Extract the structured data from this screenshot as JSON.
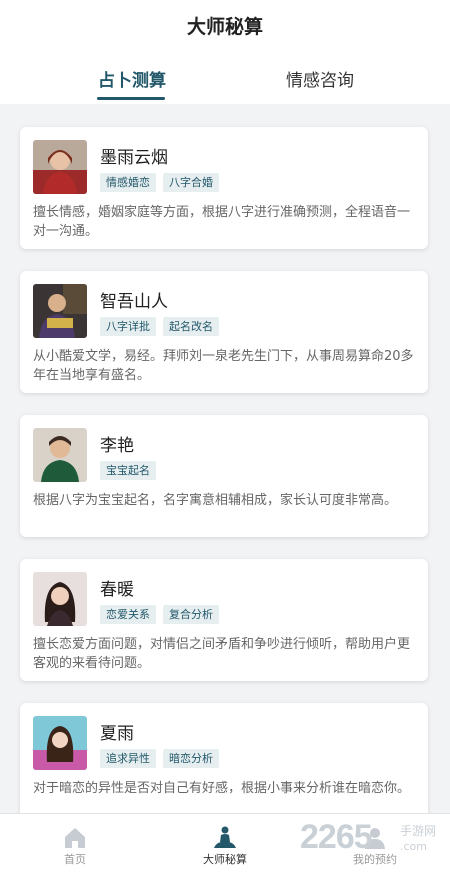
{
  "header": {
    "title": "大师秘算"
  },
  "tabs": [
    {
      "label": "占卜测算",
      "active": true
    },
    {
      "label": "情感咨询",
      "active": false
    }
  ],
  "masters": [
    {
      "name": "墨雨云烟",
      "tags": [
        "情感婚恋",
        "八字合婚"
      ],
      "desc": "擅长情感，婚姻家庭等方面，根据八字进行准确预测，全程语音一对一沟通。"
    },
    {
      "name": "智吾山人",
      "tags": [
        "八字详批",
        "起名改名"
      ],
      "desc": "从小酷爱文学，易经。拜师刘一泉老先生门下，从事周易算命20多年在当地享有盛名。"
    },
    {
      "name": "李艳",
      "tags": [
        "宝宝起名"
      ],
      "desc": "根据八字为宝宝起名，名字寓意相辅相成，家长认可度非常高。"
    },
    {
      "name": "春暖",
      "tags": [
        "恋爱关系",
        "复合分析"
      ],
      "desc": "擅长恋爱方面问题，对情侣之间矛盾和争吵进行倾听，帮助用户更客观的来看待问题。"
    },
    {
      "name": "夏雨",
      "tags": [
        "追求异性",
        "暗恋分析"
      ],
      "desc": "对于暗恋的异性是否对自己有好感，根据小事来分析谁在暗恋你。"
    }
  ],
  "bottom_nav": [
    {
      "label": "首页",
      "icon": "home-icon"
    },
    {
      "label": "大师秘算",
      "icon": "meditation-icon"
    },
    {
      "label": "我的预约",
      "icon": "user-icon"
    }
  ],
  "watermark": {
    "number": "2265",
    "site_cn": "手游网",
    "site_url": ".com"
  },
  "colors": {
    "accent": "#22586a",
    "tag_bg": "#e6eef0"
  }
}
